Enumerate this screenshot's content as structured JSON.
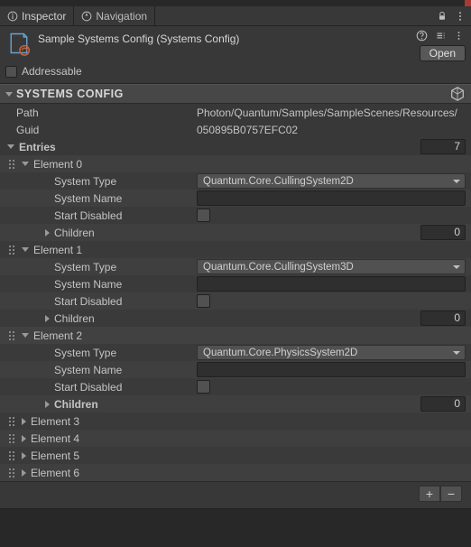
{
  "tabs": {
    "inspector": "Inspector",
    "navigation": "Navigation"
  },
  "asset": {
    "title": "Sample Systems Config (Systems Config)",
    "open": "Open"
  },
  "addressable_label": "Addressable",
  "section_title": "SYSTEMS CONFIG",
  "path": {
    "label": "Path",
    "value": "Photon/Quantum/Samples/SampleScenes/Resources/"
  },
  "guid": {
    "label": "Guid",
    "value": "050895B0757EFC02"
  },
  "entries": {
    "label": "Entries",
    "count": "7"
  },
  "labels": {
    "system_type": "System Type",
    "system_name": "System Name",
    "start_disabled": "Start Disabled",
    "children": "Children"
  },
  "elements": [
    {
      "name": "Element 0",
      "expanded": true,
      "selected": false,
      "children_bold": false,
      "system_type": "Quantum.Core.CullingSystem2D",
      "system_name": "",
      "start_disabled": false,
      "children_count": "0"
    },
    {
      "name": "Element 1",
      "expanded": true,
      "selected": false,
      "children_bold": false,
      "system_type": "Quantum.Core.CullingSystem3D",
      "system_name": "",
      "start_disabled": false,
      "children_count": "0"
    },
    {
      "name": "Element 2",
      "expanded": true,
      "selected": true,
      "children_bold": true,
      "system_type": "Quantum.Core.PhysicsSystem2D",
      "system_name": "",
      "start_disabled": false,
      "children_count": "0"
    },
    {
      "name": "Element 3",
      "expanded": false
    },
    {
      "name": "Element 4",
      "expanded": false
    },
    {
      "name": "Element 5",
      "expanded": false
    },
    {
      "name": "Element 6",
      "expanded": false
    }
  ]
}
